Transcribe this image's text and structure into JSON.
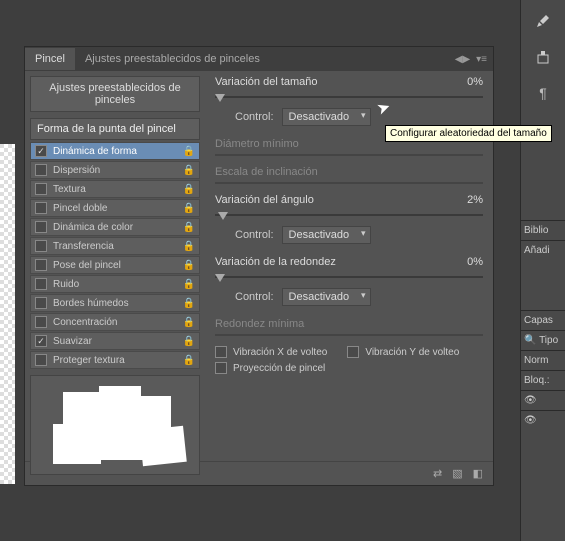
{
  "tabs": {
    "brush": "Pincel",
    "presets": "Ajustes preestablecidos de pinceles"
  },
  "preset_button": "Ajustes preestablecidos de pinceles",
  "tip_header": "Forma de la punta del pincel",
  "options": [
    {
      "label": "Dinámica de forma",
      "checked": true,
      "active": true
    },
    {
      "label": "Dispersión",
      "checked": false
    },
    {
      "label": "Textura",
      "checked": false
    },
    {
      "label": "Pincel doble",
      "checked": false
    },
    {
      "label": "Dinámica de color",
      "checked": false
    },
    {
      "label": "Transferencia",
      "checked": false
    },
    {
      "label": "Pose del pincel",
      "checked": false
    },
    {
      "label": "Ruido",
      "checked": false
    },
    {
      "label": "Bordes húmedos",
      "checked": false
    },
    {
      "label": "Concentración",
      "checked": false
    },
    {
      "label": "Suavizar",
      "checked": true
    },
    {
      "label": "Proteger textura",
      "checked": false
    }
  ],
  "controls": {
    "size_jitter": {
      "label": "Variación del tamaño",
      "value": "0%"
    },
    "control_label": "Control:",
    "control_value": "Desactivado",
    "min_diameter": "Diámetro mínimo",
    "tilt_scale": "Escala de inclinación",
    "angle_jitter": {
      "label": "Variación del ángulo",
      "value": "2%"
    },
    "roundness_jitter": {
      "label": "Variación de la redondez",
      "value": "0%"
    },
    "min_roundness": "Redondez mínima",
    "flip_x": "Vibración X de volteo",
    "flip_y": "Vibración Y de volteo",
    "brush_projection": "Proyección de pincel"
  },
  "tooltip": "Configurar aleatoriedad del tamaño",
  "side_panels": {
    "biblio": "Biblio",
    "anadir": "Añadi",
    "capas": "Capas",
    "tipo": "Tipo",
    "norm": "Norm",
    "bloq": "Bloq.:"
  }
}
